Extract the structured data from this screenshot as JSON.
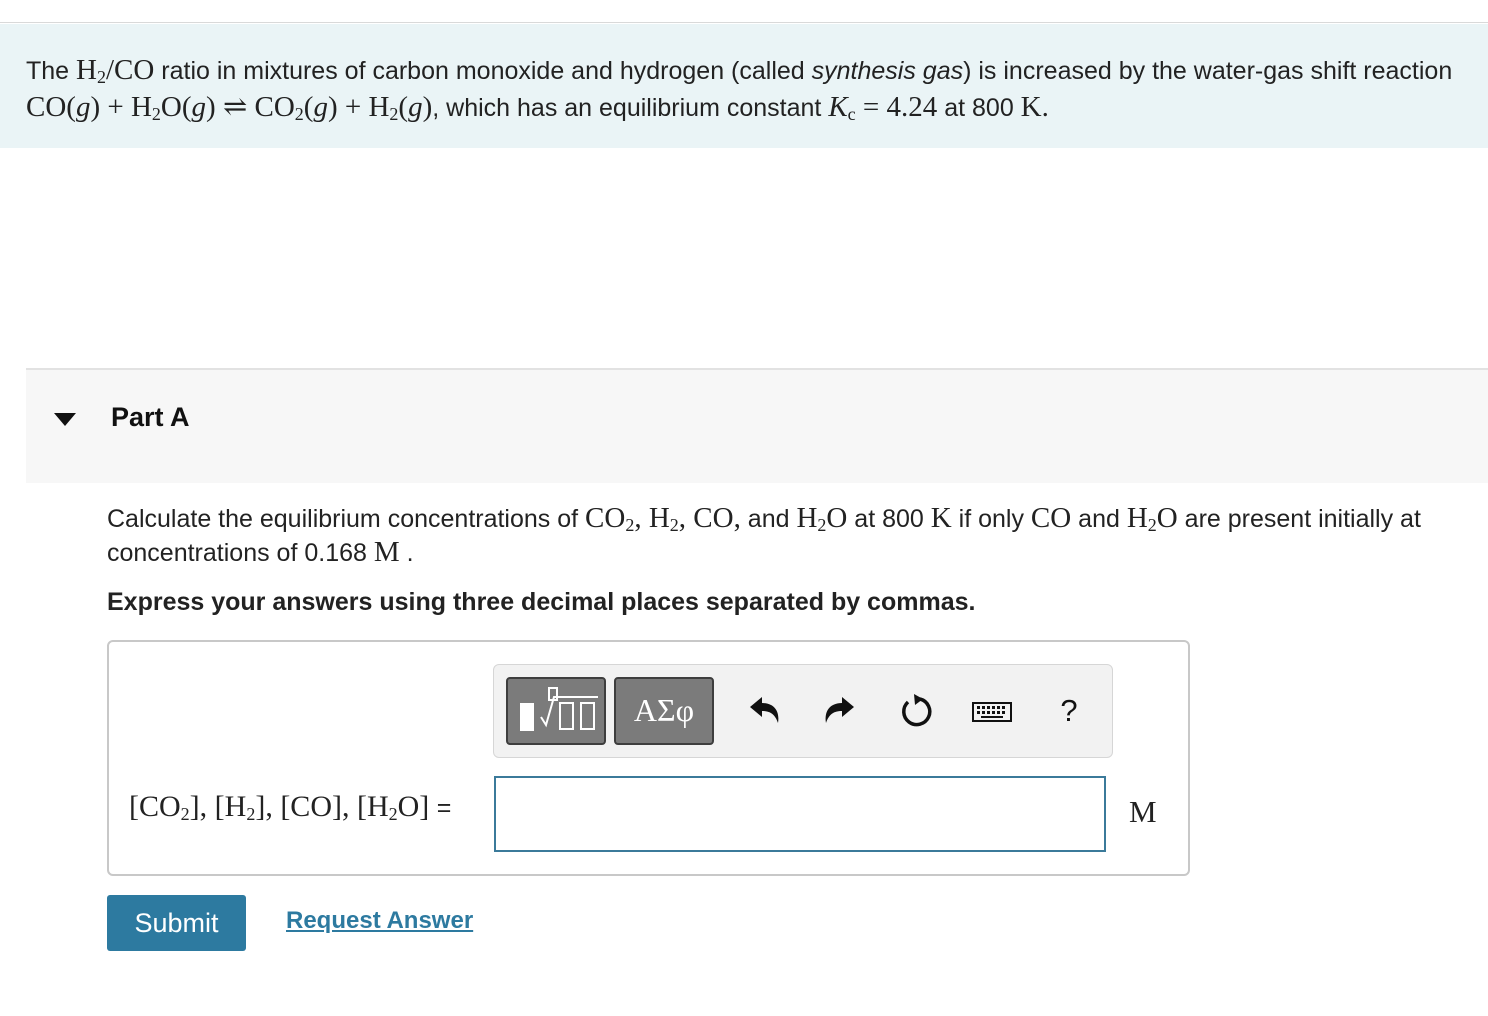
{
  "intro": {
    "t1": "The ",
    "t2": " ratio in mixtures of carbon monoxide and hydrogen (called ",
    "t3": "synthesis gas",
    "t4": ") is increased by the water-gas shift reaction ",
    "t5": ", which has an equilibrium constant ",
    "t6": " at 800 ",
    "kc_value": "4.24",
    "temp_unit": "K."
  },
  "part": {
    "label": "Part A"
  },
  "question": {
    "q1": "Calculate the equilibrium concentrations of ",
    "q2": " and ",
    "q3": " at 800 ",
    "q4": " if only ",
    "q5": " and ",
    "q6": " are present initially at concentrations of 0.168 ",
    "q7": " .",
    "unit_M": "M",
    "unit_K": "K"
  },
  "instruction": "Express your answers using three decimal places separated by commas.",
  "toolbar": {
    "greek_label": "ΑΣφ",
    "help_label": "?"
  },
  "answer": {
    "value": "",
    "unit": "M"
  },
  "actions": {
    "submit_label": "Submit",
    "request_label": "Request Answer"
  }
}
